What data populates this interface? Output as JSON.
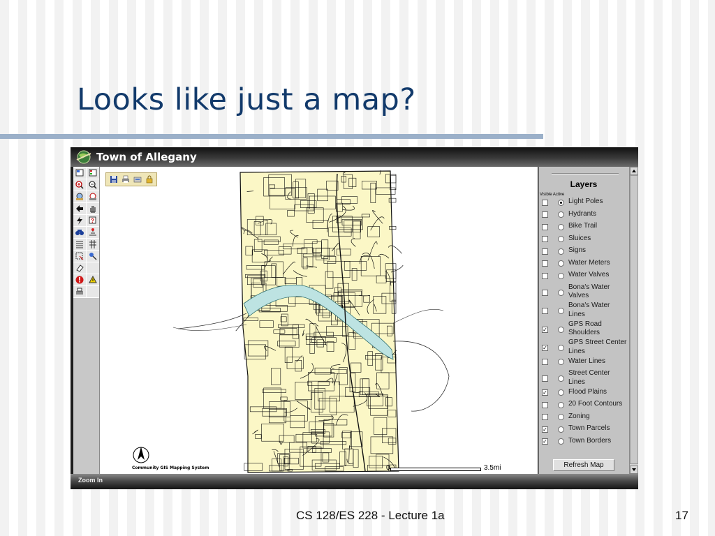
{
  "slide": {
    "title": "Looks like just a map?",
    "footer": "CS 128/ES 228 - Lecture 1a",
    "page_number": "17"
  },
  "app": {
    "window_title": "Town of Allegany",
    "status_text": "Zoom In",
    "map": {
      "credit": "Community GIS Mapping System",
      "scale_start": "0",
      "scale_end": "3.5mi",
      "colors": {
        "land": "#fbf7c6",
        "water": "#bde3e2",
        "lines": "#111111"
      }
    },
    "toolbox": {
      "tools": [
        "layout-icon",
        "legend-icon",
        "zoom-in-icon",
        "zoom-out-icon",
        "full-extent-icon",
        "zoom-prev-icon",
        "back-icon",
        "pan-icon",
        "hotlink-icon",
        "help-icon",
        "find-icon",
        "select-icon",
        "list-icon",
        "grid-icon",
        "select-rect-icon",
        "identify-icon",
        "eraser-icon",
        "blank-icon",
        "info-icon",
        "geocode-icon",
        "print-icon",
        "blank-icon"
      ]
    },
    "mini_toolbar": [
      "save-icon",
      "print-icon",
      "export-icon",
      "lock-icon"
    ],
    "layers": {
      "heading": "Layers",
      "columns_label": "Visible Active",
      "refresh_label": "Refresh Map",
      "items": [
        {
          "label": "Light Poles",
          "visible": false,
          "active": true
        },
        {
          "label": "Hydrants",
          "visible": false,
          "active": false
        },
        {
          "label": "Bike Trail",
          "visible": false,
          "active": false
        },
        {
          "label": "Sluices",
          "visible": false,
          "active": false
        },
        {
          "label": "Signs",
          "visible": false,
          "active": false
        },
        {
          "label": "Water Meters",
          "visible": false,
          "active": false
        },
        {
          "label": "Water Valves",
          "visible": false,
          "active": false
        },
        {
          "label": "Bona's Water\nValves",
          "visible": false,
          "active": false
        },
        {
          "label": "Bona's Water\nLines",
          "visible": false,
          "active": false
        },
        {
          "label": "GPS Road\nShoulders",
          "visible": true,
          "active": false
        },
        {
          "label": "GPS Street Center\nLines",
          "visible": true,
          "active": false
        },
        {
          "label": "Water Lines",
          "visible": false,
          "active": false
        },
        {
          "label": "Street Center\nLines",
          "visible": false,
          "active": false
        },
        {
          "label": "Flood Plains",
          "visible": true,
          "active": false
        },
        {
          "label": "20 Foot Contours",
          "visible": false,
          "active": false
        },
        {
          "label": "Zoning",
          "visible": false,
          "active": false
        },
        {
          "label": "Town Parcels",
          "visible": true,
          "active": false
        },
        {
          "label": "Town Borders",
          "visible": true,
          "active": false
        }
      ]
    }
  }
}
